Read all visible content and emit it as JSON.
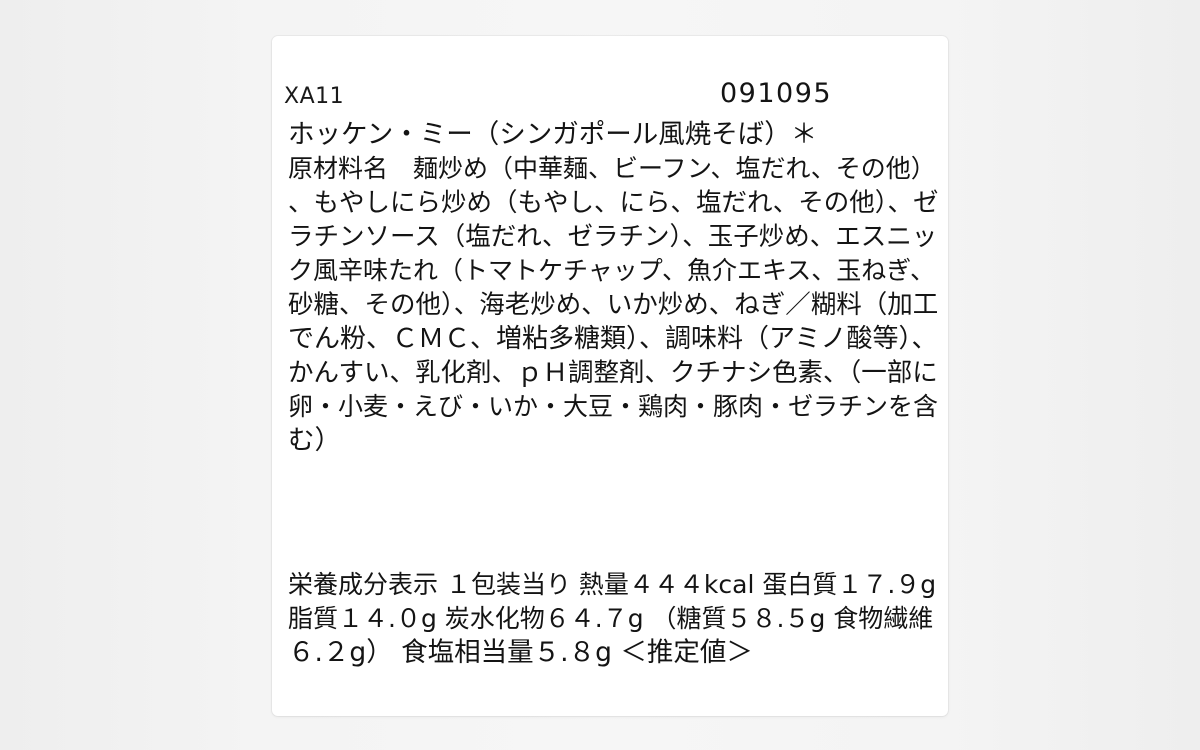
{
  "label": {
    "code": "XA11",
    "number": "091095",
    "product_name": "ホッケン・ミー（シンガポール風焼そば）＊",
    "ingredients": [
      "原材料名　麺炒め（中華麺、ビーフン、塩だれ、その他）",
      "、もやしにら炒め（もやし、にら、塩だれ、その他）、ゼ",
      "ラチンソース（塩だれ、ゼラチン）、玉子炒め、エスニッ",
      "ク風辛味たれ（トマトケチャップ、魚介エキス、玉ねぎ、",
      "砂糖、その他）、海老炒め、いか炒め、ねぎ／糊料（加工",
      "でん粉、ＣＭＣ、増粘多糖類）、調味料（アミノ酸等）、",
      "かんすい、乳化剤、ｐＨ調整剤、クチナシ色素、（一部に",
      "卵・小麦・えび・いか・大豆・鶏肉・豚肉・ゼラチンを含",
      "む）"
    ],
    "nutrition": [
      "栄養成分表示 １包装当り 熱量４４４kcal 蛋白質１７.９g",
      "脂質１４.０g 炭水化物６４.７g （糖質５８.５g 食物繊維",
      "６.２g） 食塩相当量５.８g ＜推定値＞"
    ]
  }
}
